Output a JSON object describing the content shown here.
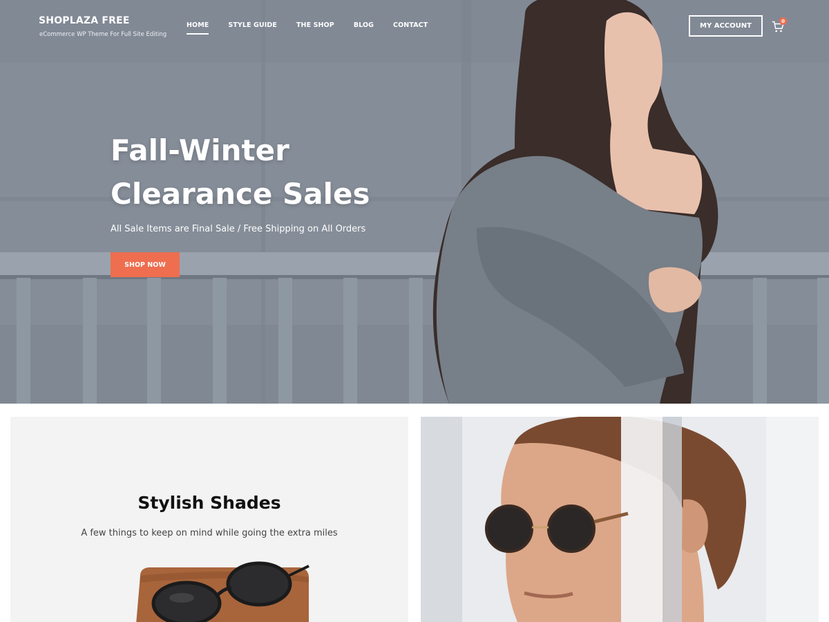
{
  "header": {
    "site_title": "SHOPLAZA FREE",
    "tagline": "eCommerce WP Theme For Full Site Editing",
    "nav": [
      {
        "label": "HOME",
        "active": true
      },
      {
        "label": "STYLE GUIDE",
        "active": false
      },
      {
        "label": "THE SHOP",
        "active": false
      },
      {
        "label": "BLOG",
        "active": false
      },
      {
        "label": "CONTACT",
        "active": false
      }
    ],
    "account_label": "MY ACCOUNT",
    "cart_count": "0",
    "cart_icon": "cart-icon"
  },
  "hero": {
    "title_line1": "Fall-Winter",
    "title_line2": "Clearance Sales",
    "subtitle": "All Sale Items are Final Sale / Free Shipping on All Orders",
    "button_label": "SHOP NOW",
    "image": "woman-in-knit-sweater"
  },
  "promo_left": {
    "title": "Stylish Shades",
    "subtitle": "A few things to keep on mind while going the extra miles",
    "image": "sunglasses-on-leather-pouch"
  },
  "promo_right": {
    "image": "man-wearing-sunglasses"
  },
  "colors": {
    "accent": "#ee6e4f",
    "card_bg": "#f3f3f3",
    "text_dark": "#111111"
  }
}
